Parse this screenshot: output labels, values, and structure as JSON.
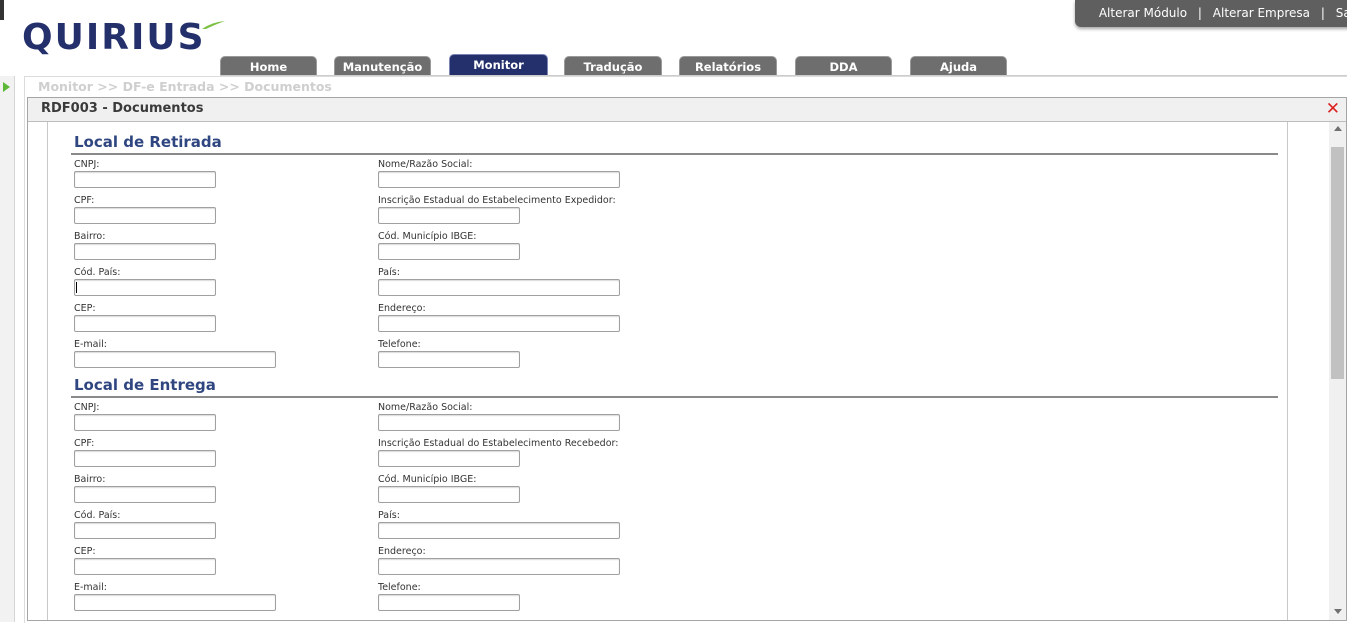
{
  "app": {
    "logo_text": "QUIRIUS"
  },
  "topbar": {
    "items": [
      "Alterar Módulo",
      "Alterar Empresa",
      "Sair"
    ],
    "separator": "|"
  },
  "nav": {
    "tabs": [
      "Home",
      "Manutenção",
      "Monitor",
      "Tradução",
      "Relatórios",
      "DDA",
      "Ajuda"
    ],
    "active": "Monitor"
  },
  "breadcrumb": "Monitor >> DF-e Entrada >> Documentos",
  "panel": {
    "title": "RDF003 - Documentos",
    "close_icon": "close-icon"
  },
  "sections": [
    {
      "title": "Local de Retirada",
      "fields": [
        {
          "label": "CNPJ:",
          "value": ""
        },
        {
          "label": "Nome/Razão Social:",
          "value": ""
        },
        {
          "label": "CPF:",
          "value": ""
        },
        {
          "label": "Inscrição Estadual do Estabelecimento Expedidor:",
          "value": ""
        },
        {
          "label": "Bairro:",
          "value": ""
        },
        {
          "label": "Cód. Município IBGE:",
          "value": ""
        },
        {
          "label": "Cód. País:",
          "value": ""
        },
        {
          "label": "País:",
          "value": ""
        },
        {
          "label": "CEP:",
          "value": ""
        },
        {
          "label": "Endereço:",
          "value": ""
        },
        {
          "label": "E-mail:",
          "value": ""
        },
        {
          "label": "Telefone:",
          "value": ""
        }
      ]
    },
    {
      "title": "Local de Entrega",
      "fields": [
        {
          "label": "CNPJ:",
          "value": ""
        },
        {
          "label": "Nome/Razão Social:",
          "value": ""
        },
        {
          "label": "CPF:",
          "value": ""
        },
        {
          "label": "Inscrição Estadual do Estabelecimento Recebedor:",
          "value": ""
        },
        {
          "label": "Bairro:",
          "value": ""
        },
        {
          "label": "Cód. Município IBGE:",
          "value": ""
        },
        {
          "label": "Cód. País:",
          "value": ""
        },
        {
          "label": "País:",
          "value": ""
        },
        {
          "label": "CEP:",
          "value": ""
        },
        {
          "label": "Endereço:",
          "value": ""
        },
        {
          "label": "E-mail:",
          "value": ""
        },
        {
          "label": "Telefone:",
          "value": ""
        }
      ]
    }
  ],
  "colors": {
    "brand": "#24306b",
    "section_title": "#2f4680",
    "close": "#dd2222",
    "expand_arrow": "#5cb836"
  }
}
